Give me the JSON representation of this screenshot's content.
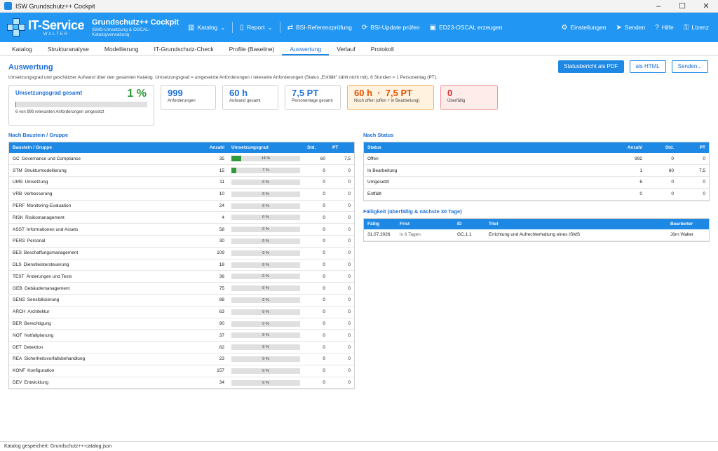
{
  "window": {
    "title": "ISW Grundschutz++ Cockpit",
    "controls": [
      "–",
      "☐",
      "✕"
    ]
  },
  "header": {
    "logo_big": "IT-Service",
    "logo_small": "WALTER",
    "app_title": "Grundschutz++ Cockpit",
    "app_subtitle": "ISMS-Umsetzung & OSCAL-Katalogverwaltung",
    "toolbar": [
      {
        "icon": "▥",
        "label": "Katalog",
        "dropdown": true
      },
      {
        "icon": "▯",
        "label": "Report",
        "dropdown": true
      },
      {
        "icon": "⇄",
        "label": "BSI-Referenzprüfung"
      },
      {
        "icon": "⟳",
        "label": "BSI-Update prüfen"
      },
      {
        "icon": "▣",
        "label": "ED23-OSCAL erzeugen"
      }
    ],
    "toolbar_right": [
      {
        "icon": "⚙",
        "label": "Einstellungen"
      },
      {
        "icon": "➤",
        "label": "Senden"
      },
      {
        "icon": "?",
        "label": "Hilfe"
      },
      {
        "icon": "⚿",
        "label": "Lizenz"
      }
    ]
  },
  "tabs": [
    "Katalog",
    "Strukturanalyse",
    "Modellierung",
    "IT-Grundschutz-Check",
    "Profile (Baseline)",
    "Auswertung",
    "Verlauf",
    "Protokoll"
  ],
  "active_tab": 5,
  "main": {
    "title": "Auswertung",
    "description": "Umsetzungsgrad und geschätzter Aufwand über den gesamten Katalog. Umsetzungsgrad = umgesetzte Anforderungen / relevante Anforderungen (Status „Entfällt“ zählt nicht mit). 8 Stunden = 1 Personentag (PT).",
    "buttons": {
      "pdf": "Statusbericht als PDF",
      "html": "als HTML",
      "send": "Senden..."
    }
  },
  "kpi_main": {
    "label": "Umsetzungsgrad gesamt",
    "value": "1 %",
    "progress": 0.006,
    "sub": "6 von 999 relevanten Anforderungen umgesetzt"
  },
  "kpis": [
    {
      "value": "999",
      "caption": "Anforderungen",
      "variant": "normal"
    },
    {
      "value": "60 h",
      "caption": "Aufwand gesamt",
      "variant": "normal"
    },
    {
      "value": "7,5 PT",
      "caption": "Personentage gesamt",
      "variant": "normal"
    },
    {
      "value": "60 h  ·  7,5 PT",
      "caption": "Noch offen (offen + in Bearbeitung)",
      "variant": "warn"
    },
    {
      "value": "0",
      "caption": "Überfällig",
      "variant": "danger"
    }
  ],
  "bausteine": {
    "section_title": "Nach Baustein / Gruppe",
    "headers": [
      "Baustein / Gruppe",
      "Anzahl",
      "Umsetzungsgrad",
      "Std.",
      "PT"
    ],
    "rows": [
      {
        "code": "GC",
        "name": "Governance und Compliance",
        "count": "35",
        "pct": 14,
        "pct_label": "14 %",
        "std": "60",
        "pt": "7,5"
      },
      {
        "code": "STM",
        "name": "Strukturmodellierung",
        "count": "15",
        "pct": 7,
        "pct_label": "7 %",
        "std": "0",
        "pt": "0"
      },
      {
        "code": "UMS",
        "name": "Umsetzung",
        "count": "11",
        "pct": 0,
        "pct_label": "0 %",
        "std": "0",
        "pt": "0"
      },
      {
        "code": "VRB",
        "name": "Verbesserung",
        "count": "10",
        "pct": 0,
        "pct_label": "0 %",
        "std": "0",
        "pt": "0"
      },
      {
        "code": "PERF",
        "name": "Monitoring-Evaluation",
        "count": "24",
        "pct": 0,
        "pct_label": "0 %",
        "std": "0",
        "pt": "0"
      },
      {
        "code": "RISK",
        "name": "Risikomanagement",
        "count": "4",
        "pct": 0,
        "pct_label": "0 %",
        "std": "0",
        "pt": "0"
      },
      {
        "code": "ASST",
        "name": "Informationen und Assets",
        "count": "58",
        "pct": 0,
        "pct_label": "0 %",
        "std": "0",
        "pt": "0"
      },
      {
        "code": "PERS",
        "name": "Personal",
        "count": "30",
        "pct": 0,
        "pct_label": "0 %",
        "std": "0",
        "pt": "0"
      },
      {
        "code": "BES",
        "name": "Beschaffungsmanagement",
        "count": "109",
        "pct": 0,
        "pct_label": "0 %",
        "std": "0",
        "pt": "0"
      },
      {
        "code": "DLS",
        "name": "Dienstleistersteuerung",
        "count": "18",
        "pct": 0,
        "pct_label": "0 %",
        "std": "0",
        "pt": "0"
      },
      {
        "code": "TEST",
        "name": "Änderungen und Tests",
        "count": "36",
        "pct": 0,
        "pct_label": "0 %",
        "std": "0",
        "pt": "0"
      },
      {
        "code": "GEB",
        "name": "Gebäudemanagement",
        "count": "75",
        "pct": 0,
        "pct_label": "0 %",
        "std": "0",
        "pt": "0"
      },
      {
        "code": "SENS",
        "name": "Sensibilisierung",
        "count": "88",
        "pct": 0,
        "pct_label": "0 %",
        "std": "0",
        "pt": "0"
      },
      {
        "code": "ARCH",
        "name": "Architektur",
        "count": "63",
        "pct": 0,
        "pct_label": "0 %",
        "std": "0",
        "pt": "0"
      },
      {
        "code": "BER",
        "name": "Berechtigung",
        "count": "90",
        "pct": 0,
        "pct_label": "0 %",
        "std": "0",
        "pt": "0"
      },
      {
        "code": "NOT",
        "name": "Notfallplanung",
        "count": "37",
        "pct": 0,
        "pct_label": "0 %",
        "std": "0",
        "pt": "0"
      },
      {
        "code": "DET",
        "name": "Detektion",
        "count": "82",
        "pct": 0,
        "pct_label": "0 %",
        "std": "0",
        "pt": "0"
      },
      {
        "code": "REA",
        "name": "Sicherheitsvorfallsbehandlung",
        "count": "23",
        "pct": 0,
        "pct_label": "0 %",
        "std": "0",
        "pt": "0"
      },
      {
        "code": "KONF",
        "name": "Konfiguration",
        "count": "157",
        "pct": 0,
        "pct_label": "0 %",
        "std": "0",
        "pt": "0"
      },
      {
        "code": "DEV",
        "name": "Entwicklung",
        "count": "34",
        "pct": 0,
        "pct_label": "0 %",
        "std": "0",
        "pt": "0"
      }
    ]
  },
  "status": {
    "section_title": "Nach Status",
    "headers": [
      "Status",
      "Anzahl",
      "Std.",
      "PT"
    ],
    "rows": [
      {
        "status": "Offen",
        "count": "992",
        "std": "0",
        "pt": "0"
      },
      {
        "status": "In Bearbeitung",
        "count": "1",
        "std": "60",
        "pt": "7,5"
      },
      {
        "status": "Umgesetzt",
        "count": "6",
        "std": "0",
        "pt": "0"
      },
      {
        "status": "Entfällt",
        "count": "0",
        "std": "0",
        "pt": "0"
      }
    ]
  },
  "faelligkeit": {
    "section_title": "Fälligkeit (überfällig & nächste 30 Tage)",
    "headers": [
      "Fällig",
      "Frist",
      "ID",
      "Titel",
      "Bearbeiter"
    ],
    "rows": [
      {
        "due": "31.07.2026",
        "frist": "in 8 Tagen",
        "id": "GC.1.1",
        "title": "Errichtung und Aufrechterhaltung eines ISMS",
        "owner": "Jörn Walter"
      }
    ]
  },
  "statusbar": "Katalog gespeichert: Grundschutz++-catalog.json",
  "colors": {
    "accent": "#1e88e5",
    "success": "#2e9a3a",
    "warn": "#e65100",
    "danger": "#d32f2f"
  }
}
